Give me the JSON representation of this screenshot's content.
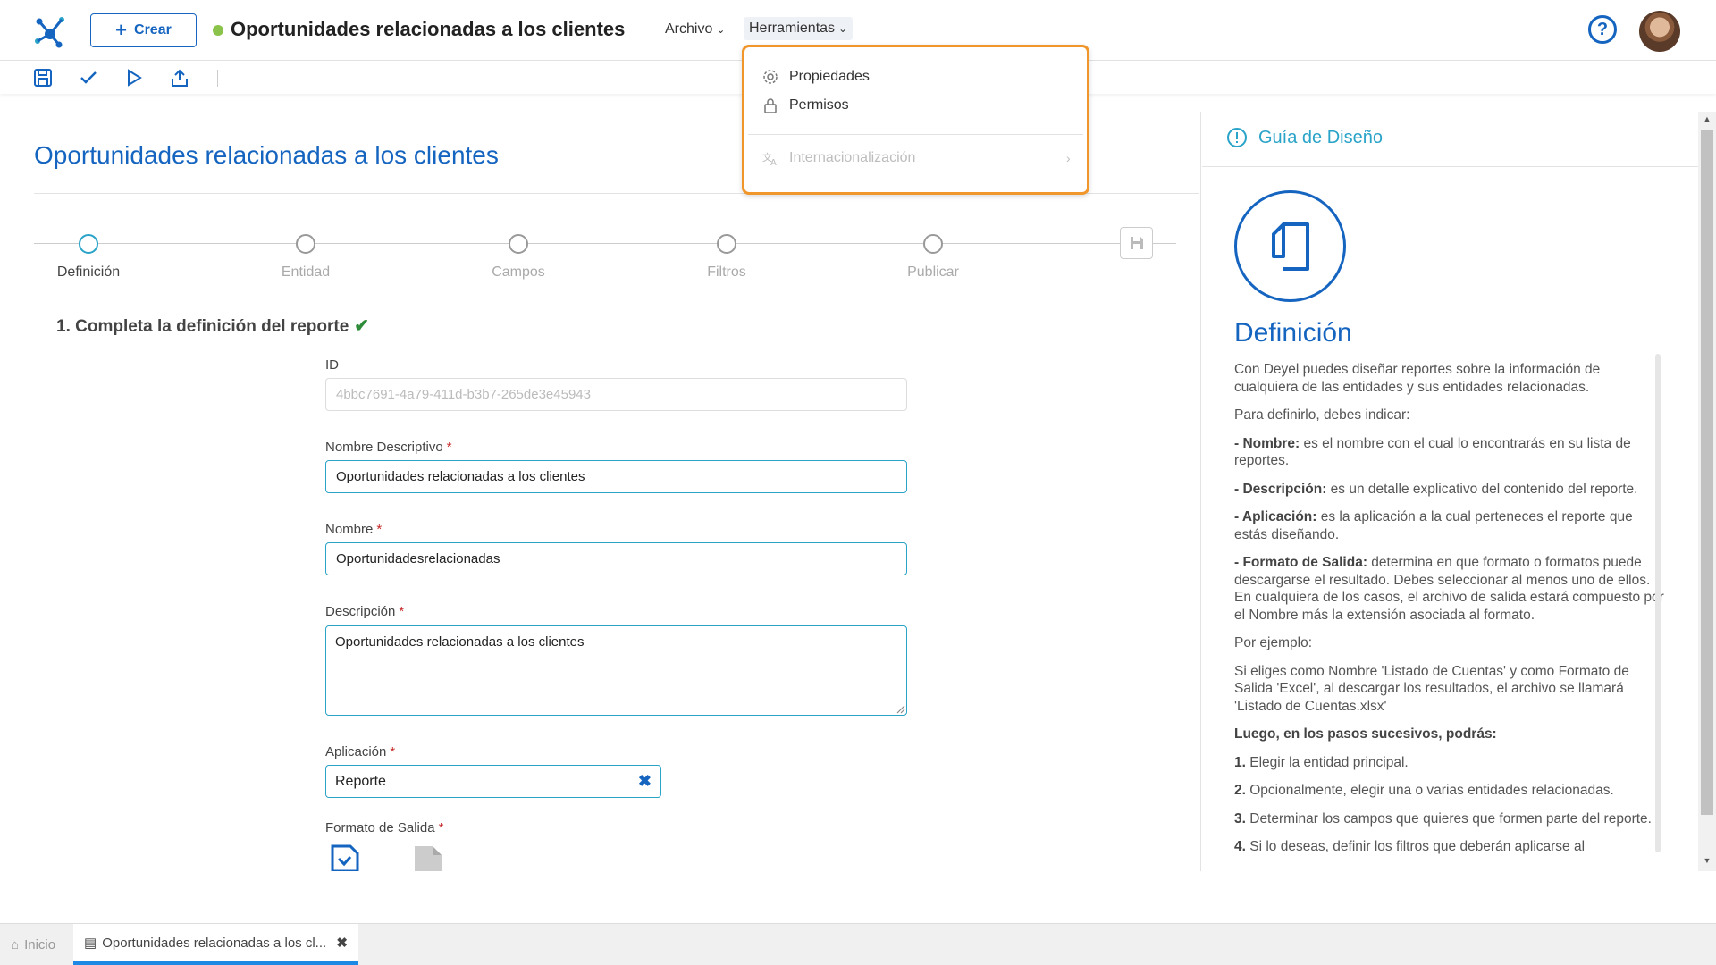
{
  "header": {
    "create_label": "Crear",
    "page_name": "Oportunidades relacionadas a los clientes",
    "menus": [
      {
        "label": "Archivo"
      },
      {
        "label": "Herramientas"
      }
    ],
    "help_icon": "help-circle-icon",
    "status_color": "#8bc34a"
  },
  "toolbar": {
    "icons": [
      "save-icon",
      "check-icon",
      "play-icon",
      "export-icon"
    ]
  },
  "dropdown": {
    "items": [
      {
        "label": "Propiedades",
        "icon": "gear-icon"
      },
      {
        "label": "Permisos",
        "icon": "lock-icon"
      },
      {
        "label": "Internacionalización",
        "icon": "translate-icon",
        "disabled": true
      }
    ],
    "highlight_color": "#f0962a"
  },
  "main": {
    "title": "Oportunidades relacionadas a los clientes",
    "steps": [
      {
        "label": "Definición",
        "active": true
      },
      {
        "label": "Entidad"
      },
      {
        "label": "Campos"
      },
      {
        "label": "Filtros"
      },
      {
        "label": "Publicar"
      }
    ],
    "section_heading": "1. Completa la definición del reporte",
    "fields": {
      "id": {
        "label": "ID",
        "value": "4bbc7691-4a79-411d-b3b7-265de3e45943"
      },
      "nombre_descriptivo": {
        "label": "Nombre Descriptivo",
        "value": "Oportunidades relacionadas a los clientes"
      },
      "nombre": {
        "label": "Nombre",
        "value": "Oportunidadesrelacionadas"
      },
      "descripcion": {
        "label": "Descripción",
        "value": "Oportunidades relacionadas a los clientes"
      },
      "aplicacion": {
        "label": "Aplicación",
        "value": "Reporte"
      },
      "formato_salida": {
        "label": "Formato de Salida"
      }
    },
    "required_mark": "*",
    "accent_color": "#1565c0"
  },
  "guide": {
    "title": "Guía de Diseño",
    "heading": "Definición",
    "p1": "Con Deyel puedes diseñar reportes sobre la información de cualquiera de las entidades y sus entidades relacionadas.",
    "p2": "Para definirlo, debes indicar:",
    "items": [
      {
        "term": "- Nombre:",
        "text": " es el nombre con el cual lo encontrarás en su lista de reportes."
      },
      {
        "term": "- Descripción:",
        "text": " es un detalle explicativo del contenido del reporte."
      },
      {
        "term": "- Aplicación:",
        "text": " es la aplicación a la cual perteneces el reporte que estás diseñando."
      },
      {
        "term": "- Formato de Salida:",
        "text": " determina en que formato o formatos puede descargarse el resultado. Debes seleccionar al menos uno de ellos. En cualquiera de los casos, el archivo de salida estará compuesto por el Nombre más la extensión asociada al formato."
      }
    ],
    "p_example_label": "Por ejemplo:",
    "p_example": "Si eliges como Nombre 'Listado de Cuentas' y como Formato de Salida 'Excel', al descargar los resultados, el archivo se llamará 'Listado de Cuentas.xlsx'",
    "steps_heading": "Luego, en los pasos sucesivos, podrás:",
    "steps": [
      {
        "num": "1.",
        "text": " Elegir la entidad principal."
      },
      {
        "num": "2.",
        "text": " Opcionalmente, elegir una o varias entidades relacionadas."
      },
      {
        "num": "3.",
        "text": " Determinar los campos que quieres que formen parte del reporte."
      },
      {
        "num": "4.",
        "text": " Si lo deseas, definir los filtros que deberán aplicarse al"
      }
    ]
  },
  "bottom_tabs": [
    {
      "label": "Inicio",
      "icon": "home-icon"
    },
    {
      "label": "Oportunidades relacionadas a los cl...",
      "icon": "report-icon",
      "active": true
    }
  ]
}
